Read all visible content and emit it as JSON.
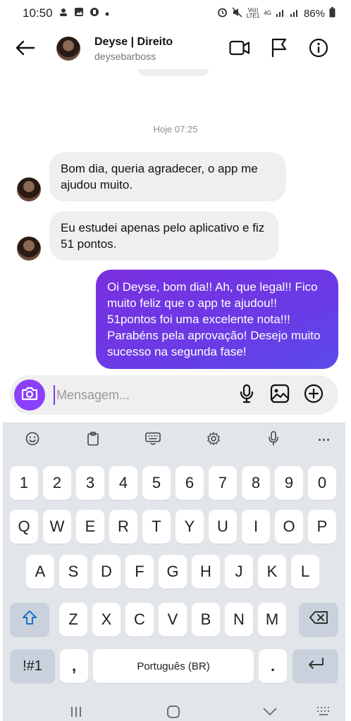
{
  "status_bar": {
    "time": "10:50",
    "volte": "Vo))",
    "lte": "LTE1",
    "network": "4G",
    "battery": "86%"
  },
  "header": {
    "name": "Deyse | Direito",
    "username": "deysebarboss"
  },
  "chat": {
    "date_separator": "Hoje 07:25",
    "messages": [
      {
        "from": "them",
        "text": "Bom dia, queria agradecer, o app me ajudou muito."
      },
      {
        "from": "them",
        "text": "Eu estudei apenas pelo aplicativo e fiz 51 pontos."
      },
      {
        "from": "me",
        "text": "Oi Deyse, bom dia!! Ah, que legal!! Fico muito feliz que o app te ajudou!! 51pontos foi uma excelente nota!!! Parabéns pela aprovação! Desejo muito sucesso na segunda fase!"
      }
    ]
  },
  "composer": {
    "placeholder": "Mensagem..."
  },
  "keyboard": {
    "row_numbers": [
      "1",
      "2",
      "3",
      "4",
      "5",
      "6",
      "7",
      "8",
      "9",
      "0"
    ],
    "row_q": [
      "Q",
      "W",
      "E",
      "R",
      "T",
      "Y",
      "U",
      "I",
      "O",
      "P"
    ],
    "row_a": [
      "A",
      "S",
      "D",
      "F",
      "G",
      "H",
      "J",
      "K",
      "L"
    ],
    "row_z": [
      "Z",
      "X",
      "C",
      "V",
      "B",
      "N",
      "M"
    ],
    "symbols_key": "!#1",
    "comma_key": ",",
    "space_label": "Português (BR)",
    "period_key": ".",
    "more_dots": "···"
  },
  "colors": {
    "accent": "#8a3ffc",
    "bubble_out_start": "#7a2fe0",
    "bubble_out_end": "#5b4ae8",
    "bubble_in": "#efefef",
    "keyboard_bg": "#e2e6ea"
  }
}
